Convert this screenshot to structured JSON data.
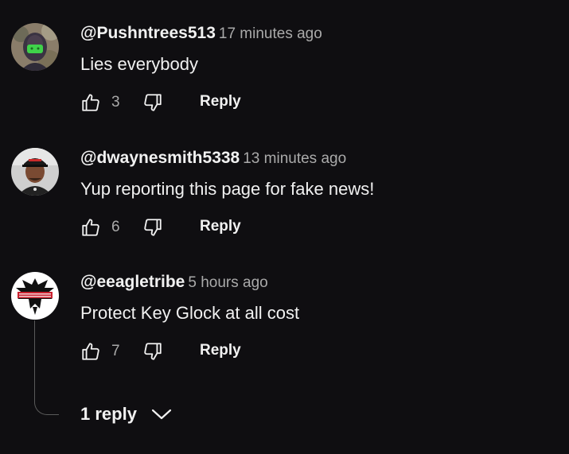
{
  "comments": [
    {
      "author": "@Pushntrees513",
      "time": "17 minutes ago",
      "text": "Lies everybody",
      "likes": "3",
      "reply_label": "Reply",
      "avatar": "masked-person-avatar"
    },
    {
      "author": "@dwaynesmith5338",
      "time": "13 minutes ago",
      "text": "Yup reporting this page for fake news!",
      "likes": "6",
      "reply_label": "Reply",
      "avatar": "man-with-cap-avatar"
    },
    {
      "author": "@eeagletribe",
      "time": "5 hours ago",
      "text": "Protect Key Glock at all cost",
      "likes": "7",
      "reply_label": "Reply",
      "avatar": "eagle-logo-avatar"
    }
  ],
  "replies_toggle": {
    "label": "1 reply",
    "icon": "chevron-down-icon"
  },
  "colors": {
    "background": "#0f0e11",
    "primary_text": "#f1f1f1",
    "secondary_text": "#aaaaaa",
    "thread_line": "#5a5a5a"
  }
}
